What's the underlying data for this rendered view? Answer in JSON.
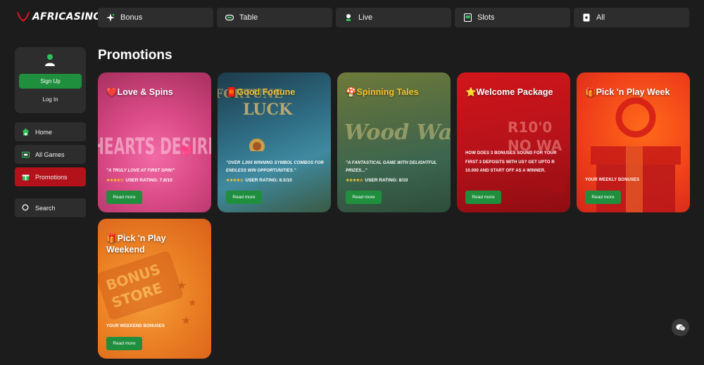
{
  "brand": {
    "name": "AFRICASINO",
    "accent": "#b3121a",
    "green": "#1f8f3e"
  },
  "topnav": [
    {
      "label": "Bonus",
      "icon": "sparkle-icon"
    },
    {
      "label": "Table",
      "icon": "chip-icon"
    },
    {
      "label": "Live",
      "icon": "live-icon"
    },
    {
      "label": "Slots",
      "icon": "slot-machine-icon"
    },
    {
      "label": "All",
      "icon": "card-icon"
    }
  ],
  "sidebar": {
    "signup_label": "Sign Up",
    "login_label": "Log In",
    "items": [
      {
        "label": "Home",
        "icon": "home-icon"
      },
      {
        "label": "All Games",
        "icon": "games-icon"
      },
      {
        "label": "Promotions",
        "icon": "gift-icon",
        "active": true
      }
    ],
    "search_label": "Search"
  },
  "main": {
    "title": "Promotions",
    "read_more": "Read more",
    "cards": [
      {
        "emoji": "❤️",
        "title": "Love & Spins",
        "desc": "\"A truly love at first spin!\"",
        "rating": "USER RATING: 7.8/10",
        "stars": "★★★★☆"
      },
      {
        "emoji": "🧧",
        "title": "Good Fortune",
        "desc": "\"Over 1,000 winning symbol combos for endless win opportunities.\"",
        "rating": "USER RATING: 8.5/10",
        "stars": "★★★★☆"
      },
      {
        "emoji": "🍄",
        "title": "Spinning Tales",
        "desc": "\"A fantastical game with delightful prizes...\"",
        "rating": "USER RATING: 8/10",
        "stars": "★★★★☆"
      },
      {
        "emoji": "⭐",
        "title": "Welcome Package",
        "desc": "How does 3 bonuses sound for your first 3 deposits with us? Get upto R 10.000 and start off as a winner."
      },
      {
        "emoji": "🎁",
        "title": "Pick 'n Play Week",
        "desc": "Your weekly bonuses"
      },
      {
        "emoji": "🎁",
        "title": "Pick 'n Play Weekend",
        "desc": "Your weekend bonuses"
      }
    ],
    "background_text": {
      "c0": "HEARTS DESIRE",
      "c1a": "FORTUNE",
      "c1b": "LUCK",
      "c2": "Wood Wanders",
      "c3a": "R10'0",
      "c3b": "NO WA",
      "c5a": "BONUS",
      "c5b": "STORE"
    }
  }
}
